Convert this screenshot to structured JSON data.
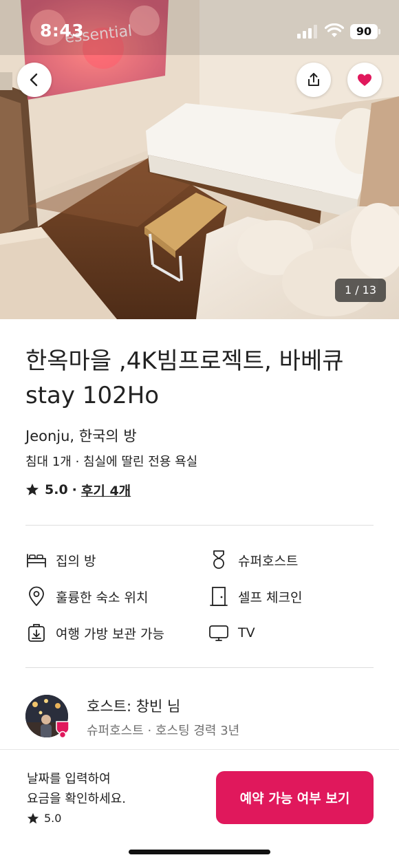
{
  "status_bar": {
    "time": "8:43",
    "battery": "90"
  },
  "photo": {
    "counter": "1 / 13",
    "projected_text": "essential"
  },
  "listing": {
    "title_line1": "한옥마을 ,4K빔프로젝트, 바베큐",
    "title_line2": "stay 102Ho",
    "location": "Jeonju, 한국의 방",
    "details": "침대 1개 · 침실에 딸린 전용 욕실",
    "rating": "5.0",
    "separator": "·",
    "reviews": "후기 4개"
  },
  "amenities": [
    {
      "label": "집의 방",
      "icon": "bed-icon"
    },
    {
      "label": "훌륭한 숙소 위치",
      "icon": "location-pin-icon"
    },
    {
      "label": "여행 가방 보관 가능",
      "icon": "luggage-icon"
    },
    {
      "label": "슈퍼호스트",
      "icon": "medal-icon"
    },
    {
      "label": "셀프 체크인",
      "icon": "door-icon"
    },
    {
      "label": "TV",
      "icon": "tv-icon"
    }
  ],
  "host": {
    "name": "호스트: 창빈 님",
    "meta": "슈퍼호스트 · 호스팅 경력 3년"
  },
  "footer": {
    "prompt_line1": "날짜를 입력하여",
    "prompt_line2": "요금을 확인하세요.",
    "rating": "5.0",
    "cta": "예약 가능 여부 보기"
  },
  "colors": {
    "brand": "#e0185c",
    "favorite_heart": "#e0185c",
    "text": "#222222",
    "muted": "#717171"
  }
}
